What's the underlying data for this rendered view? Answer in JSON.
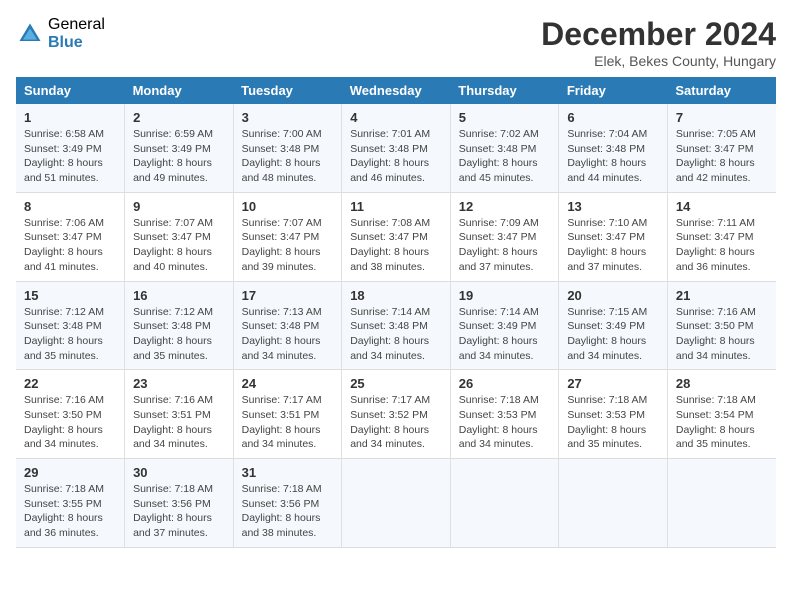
{
  "logo": {
    "general": "General",
    "blue": "Blue"
  },
  "title": "December 2024",
  "subtitle": "Elek, Bekes County, Hungary",
  "days_of_week": [
    "Sunday",
    "Monday",
    "Tuesday",
    "Wednesday",
    "Thursday",
    "Friday",
    "Saturday"
  ],
  "weeks": [
    [
      {
        "day": 1,
        "sunrise": "6:58 AM",
        "sunset": "3:49 PM",
        "daylight": "8 hours and 51 minutes."
      },
      {
        "day": 2,
        "sunrise": "6:59 AM",
        "sunset": "3:49 PM",
        "daylight": "8 hours and 49 minutes."
      },
      {
        "day": 3,
        "sunrise": "7:00 AM",
        "sunset": "3:48 PM",
        "daylight": "8 hours and 48 minutes."
      },
      {
        "day": 4,
        "sunrise": "7:01 AM",
        "sunset": "3:48 PM",
        "daylight": "8 hours and 46 minutes."
      },
      {
        "day": 5,
        "sunrise": "7:02 AM",
        "sunset": "3:48 PM",
        "daylight": "8 hours and 45 minutes."
      },
      {
        "day": 6,
        "sunrise": "7:04 AM",
        "sunset": "3:48 PM",
        "daylight": "8 hours and 44 minutes."
      },
      {
        "day": 7,
        "sunrise": "7:05 AM",
        "sunset": "3:47 PM",
        "daylight": "8 hours and 42 minutes."
      }
    ],
    [
      {
        "day": 8,
        "sunrise": "7:06 AM",
        "sunset": "3:47 PM",
        "daylight": "8 hours and 41 minutes."
      },
      {
        "day": 9,
        "sunrise": "7:07 AM",
        "sunset": "3:47 PM",
        "daylight": "8 hours and 40 minutes."
      },
      {
        "day": 10,
        "sunrise": "7:07 AM",
        "sunset": "3:47 PM",
        "daylight": "8 hours and 39 minutes."
      },
      {
        "day": 11,
        "sunrise": "7:08 AM",
        "sunset": "3:47 PM",
        "daylight": "8 hours and 38 minutes."
      },
      {
        "day": 12,
        "sunrise": "7:09 AM",
        "sunset": "3:47 PM",
        "daylight": "8 hours and 37 minutes."
      },
      {
        "day": 13,
        "sunrise": "7:10 AM",
        "sunset": "3:47 PM",
        "daylight": "8 hours and 37 minutes."
      },
      {
        "day": 14,
        "sunrise": "7:11 AM",
        "sunset": "3:47 PM",
        "daylight": "8 hours and 36 minutes."
      }
    ],
    [
      {
        "day": 15,
        "sunrise": "7:12 AM",
        "sunset": "3:48 PM",
        "daylight": "8 hours and 35 minutes."
      },
      {
        "day": 16,
        "sunrise": "7:12 AM",
        "sunset": "3:48 PM",
        "daylight": "8 hours and 35 minutes."
      },
      {
        "day": 17,
        "sunrise": "7:13 AM",
        "sunset": "3:48 PM",
        "daylight": "8 hours and 34 minutes."
      },
      {
        "day": 18,
        "sunrise": "7:14 AM",
        "sunset": "3:48 PM",
        "daylight": "8 hours and 34 minutes."
      },
      {
        "day": 19,
        "sunrise": "7:14 AM",
        "sunset": "3:49 PM",
        "daylight": "8 hours and 34 minutes."
      },
      {
        "day": 20,
        "sunrise": "7:15 AM",
        "sunset": "3:49 PM",
        "daylight": "8 hours and 34 minutes."
      },
      {
        "day": 21,
        "sunrise": "7:16 AM",
        "sunset": "3:50 PM",
        "daylight": "8 hours and 34 minutes."
      }
    ],
    [
      {
        "day": 22,
        "sunrise": "7:16 AM",
        "sunset": "3:50 PM",
        "daylight": "8 hours and 34 minutes."
      },
      {
        "day": 23,
        "sunrise": "7:16 AM",
        "sunset": "3:51 PM",
        "daylight": "8 hours and 34 minutes."
      },
      {
        "day": 24,
        "sunrise": "7:17 AM",
        "sunset": "3:51 PM",
        "daylight": "8 hours and 34 minutes."
      },
      {
        "day": 25,
        "sunrise": "7:17 AM",
        "sunset": "3:52 PM",
        "daylight": "8 hours and 34 minutes."
      },
      {
        "day": 26,
        "sunrise": "7:18 AM",
        "sunset": "3:53 PM",
        "daylight": "8 hours and 34 minutes."
      },
      {
        "day": 27,
        "sunrise": "7:18 AM",
        "sunset": "3:53 PM",
        "daylight": "8 hours and 35 minutes."
      },
      {
        "day": 28,
        "sunrise": "7:18 AM",
        "sunset": "3:54 PM",
        "daylight": "8 hours and 35 minutes."
      }
    ],
    [
      {
        "day": 29,
        "sunrise": "7:18 AM",
        "sunset": "3:55 PM",
        "daylight": "8 hours and 36 minutes."
      },
      {
        "day": 30,
        "sunrise": "7:18 AM",
        "sunset": "3:56 PM",
        "daylight": "8 hours and 37 minutes."
      },
      {
        "day": 31,
        "sunrise": "7:18 AM",
        "sunset": "3:56 PM",
        "daylight": "8 hours and 38 minutes."
      },
      null,
      null,
      null,
      null
    ]
  ]
}
